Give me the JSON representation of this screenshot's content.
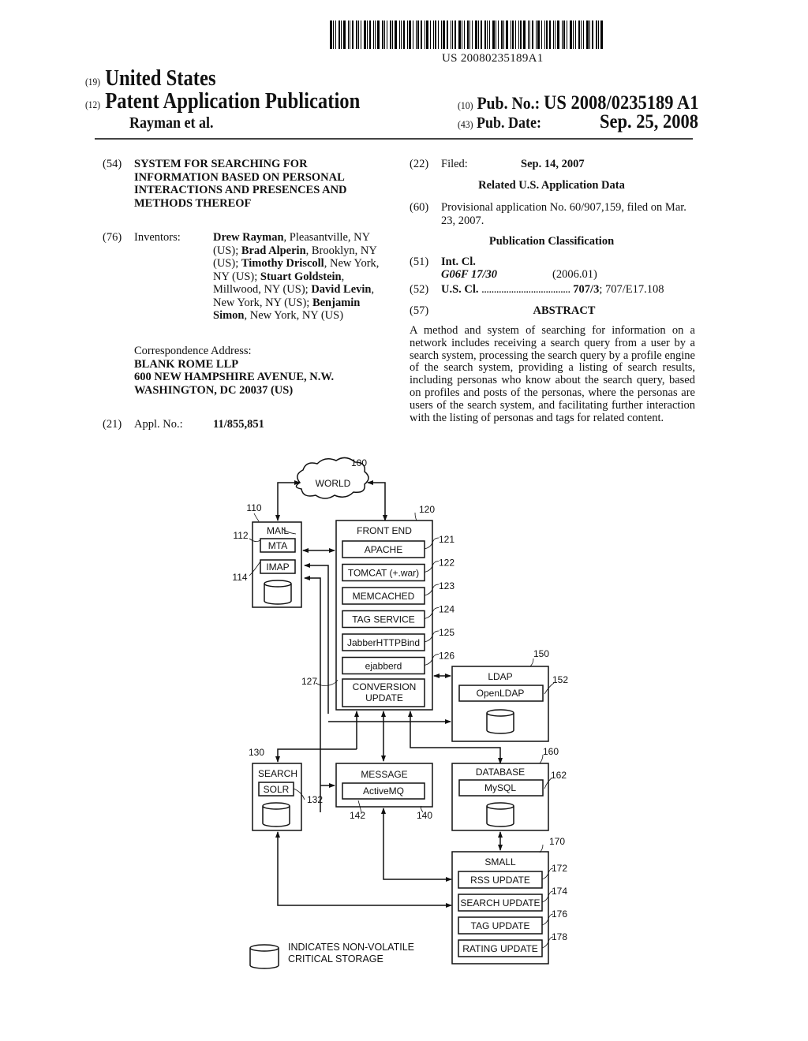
{
  "barcode": {
    "number": "US 20080235189A1"
  },
  "header": {
    "country_code": "(19)",
    "country": "United States",
    "type_code": "(12)",
    "type": "Patent Application Publication",
    "inventor_short": "Rayman et al.",
    "pub_no_code": "(10)",
    "pub_no_label": "Pub. No.:",
    "pub_no": "US 2008/0235189 A1",
    "pub_date_code": "(43)",
    "pub_date_label": "Pub. Date:",
    "pub_date": "Sep. 25, 2008"
  },
  "left": {
    "title_code": "(54)",
    "title": "SYSTEM FOR SEARCHING FOR INFORMATION BASED ON PERSONAL INTERACTIONS AND PRESENCES AND METHODS THEREOF",
    "inventors_code": "(76)",
    "inventors_label": "Inventors:",
    "inventors": [
      {
        "name": "Drew Rayman",
        "loc": ", Pleasantville, NY (US); "
      },
      {
        "name": "Brad Alperin",
        "loc": ", Brooklyn, NY (US); "
      },
      {
        "name": "Timothy Driscoll",
        "loc": ", New York, NY (US); "
      },
      {
        "name": "Stuart Goldstein",
        "loc": ", Millwood, NY (US); "
      },
      {
        "name": "David Levin",
        "loc": ", New York, NY (US); "
      },
      {
        "name": "Benjamin Simon",
        "loc": ", New York, NY (US)"
      }
    ],
    "correspondence_label": "Correspondence Address:",
    "correspondence_lines": [
      "BLANK ROME LLP",
      "600 NEW HAMPSHIRE AVENUE, N.W.",
      "WASHINGTON, DC 20037 (US)"
    ],
    "appl_code": "(21)",
    "appl_label": "Appl. No.:",
    "appl_no": "11/855,851"
  },
  "right": {
    "filed_code": "(22)",
    "filed_label": "Filed:",
    "filed_date": "Sep. 14, 2007",
    "related_heading": "Related U.S. Application Data",
    "provisional_code": "(60)",
    "provisional_text": "Provisional application No. 60/907,159, filed on Mar. 23, 2007.",
    "pubclass_heading": "Publication Classification",
    "intcl_code": "(51)",
    "intcl_label": "Int. Cl.",
    "intcl_class": "G06F 17/30",
    "intcl_version": "(2006.01)",
    "uscl_code": "(52)",
    "uscl_label": "U.S. Cl.",
    "uscl_dots": "....................................",
    "uscl_main": "707/3",
    "uscl_rest": "; 707/E17.108",
    "abstract_code": "(57)",
    "abstract_heading": "ABSTRACT",
    "abstract_text": "A method and system of searching for information on a network includes receiving a search query from a user by a search system, processing the search query by a profile engine of the search system, providing a listing of search results, including personas who know about the search query, based on profiles and posts of the personas, where the personas are users of the search system, and facilitating further interaction with the listing of personas and tags for related content."
  },
  "diagram": {
    "world": {
      "label": "WORLD",
      "ref": "100"
    },
    "mail": {
      "title": "MAIL",
      "ref": "110",
      "mta": "MTA",
      "mta_ref": "112",
      "imap": "IMAP",
      "imap_ref": "114"
    },
    "front_end": {
      "title": "FRONT END",
      "ref": "120",
      "components": [
        {
          "label": "APACHE",
          "ref": "121"
        },
        {
          "label": "TOMCAT   (+.war)",
          "ref": "122"
        },
        {
          "label": "MEMCACHED",
          "ref": "123"
        },
        {
          "label": "TAG SERVICE",
          "ref": "124"
        },
        {
          "label": "JabberHTTPBind",
          "ref": "125"
        },
        {
          "label": "ejabberd",
          "ref": "126"
        }
      ],
      "conversion": {
        "line1": "CONVERSION",
        "line2": "UPDATE",
        "ref": "127"
      }
    },
    "ldap": {
      "title": "LDAP",
      "ref": "150",
      "inner": "OpenLDAP",
      "inner_ref": "152"
    },
    "search": {
      "title": "SEARCH",
      "ref": "130",
      "inner": "SOLR",
      "inner_ref": "132"
    },
    "message": {
      "title": "MESSAGE",
      "ref": "140",
      "inner": "ActiveMQ",
      "inner_ref": "142"
    },
    "database": {
      "title": "DATABASE",
      "ref": "160",
      "inner": "MySQL",
      "inner_ref": "162"
    },
    "small": {
      "title": "SMALL",
      "ref": "170",
      "components": [
        {
          "label": "RSS UPDATE",
          "ref": "172"
        },
        {
          "label": "SEARCH UPDATE",
          "ref": "174"
        },
        {
          "label": "TAG UPDATE",
          "ref": "176"
        },
        {
          "label": "RATING UPDATE",
          "ref": "178"
        }
      ]
    },
    "legend": {
      "line1": "INDICATES NON-VOLATILE",
      "line2": "CRITICAL STORAGE"
    }
  }
}
